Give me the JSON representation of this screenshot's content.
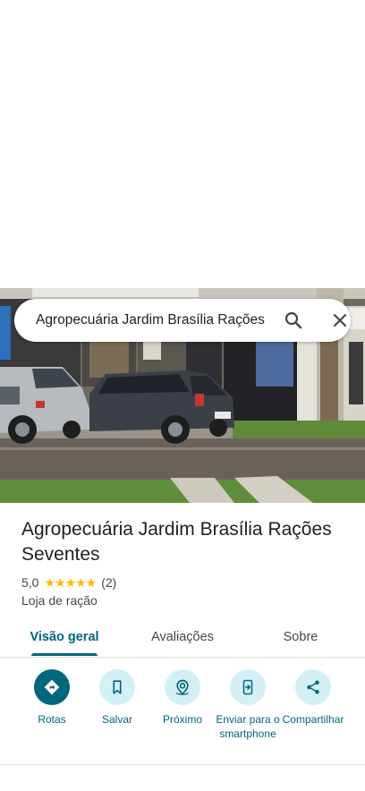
{
  "search": {
    "query": "Agropecuária Jardim Brasília Rações"
  },
  "place": {
    "name": "Agropecuária Jardim Brasília Rações Seventes",
    "rating": "5,0",
    "stars": "★★★★★",
    "review_count": "(2)",
    "category": "Loja de ração"
  },
  "tabs": [
    {
      "label": "Visão geral",
      "active": true
    },
    {
      "label": "Avaliações",
      "active": false
    },
    {
      "label": "Sobre",
      "active": false
    }
  ],
  "actions": [
    {
      "label": "Rotas",
      "icon": "directions-icon"
    },
    {
      "label": "Salvar",
      "icon": "bookmark-icon"
    },
    {
      "label": "Próximo",
      "icon": "nearby-icon"
    },
    {
      "label": "Enviar para o smartphone",
      "icon": "send-to-phone-icon"
    },
    {
      "label": "Compartilhar",
      "icon": "share-icon"
    }
  ],
  "colors": {
    "accent": "#00677d",
    "accent_light": "#d4f0f7",
    "star": "#fbbc04"
  }
}
